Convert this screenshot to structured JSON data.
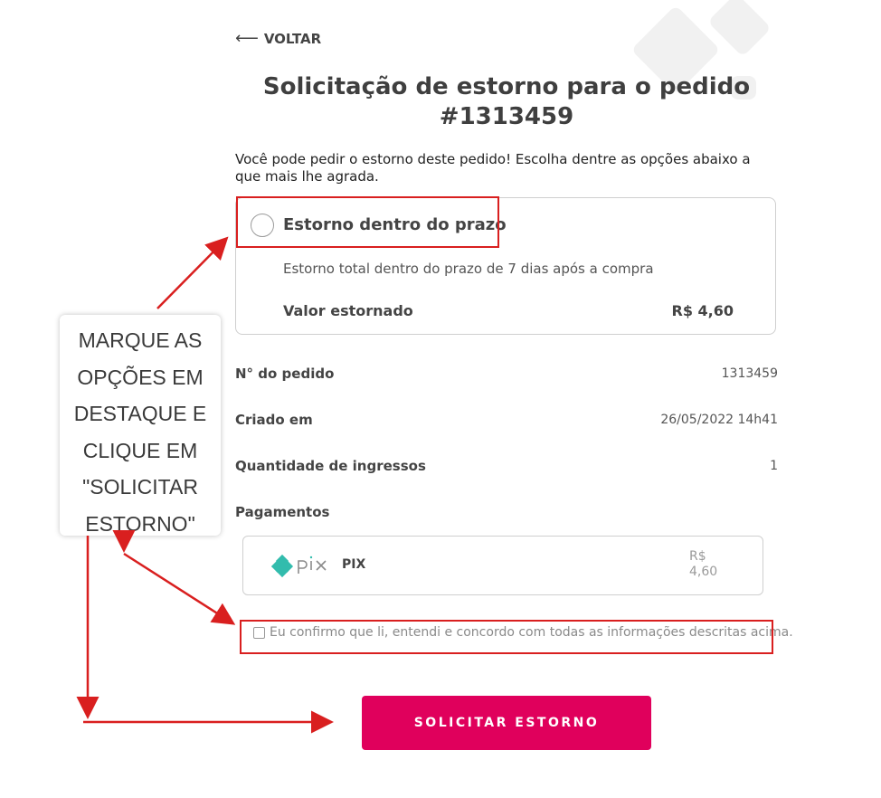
{
  "nav": {
    "back_label": "VOLTAR"
  },
  "page": {
    "title": "Solicitação de estorno para o pedido #1313459",
    "intro": "Você pode pedir o estorno deste pedido! Escolha dentre as opções abaixo a que mais lhe agrada."
  },
  "option": {
    "title": "Estorno dentro do prazo",
    "description": "Estorno total dentro do prazo de 7 dias após a compra",
    "valor_label": "Valor estornado",
    "valor_value": "R$ 4,60"
  },
  "order_info": [
    {
      "label": "N° do pedido",
      "value": "1313459"
    },
    {
      "label": "Criado em",
      "value": "26/05/2022 14h41"
    },
    {
      "label": "Quantidade de ingressos",
      "value": "1"
    }
  ],
  "payments": {
    "label": "Pagamentos",
    "method_name": "PIX",
    "amount": "R$\n4,60"
  },
  "confirm": {
    "label": "Eu confirmo que li, entendi e concordo com todas as informações descritas acima."
  },
  "submit": {
    "label": "SOLICITAR ESTORNO"
  },
  "annotation": {
    "text": "MARQUE AS\nOPÇÕES EM\nDESTAQUE E\nCLIQUE EM\n\"SOLICITAR\nESTORNO\""
  },
  "colors": {
    "accent": "#e0005c",
    "annotation_red": "#d91f1f",
    "pix_teal": "#32bcad"
  },
  "icons": [
    "back-arrow-icon",
    "radio-unchecked-icon",
    "pix-logo-icon",
    "checkbox-unchecked-icon"
  ]
}
